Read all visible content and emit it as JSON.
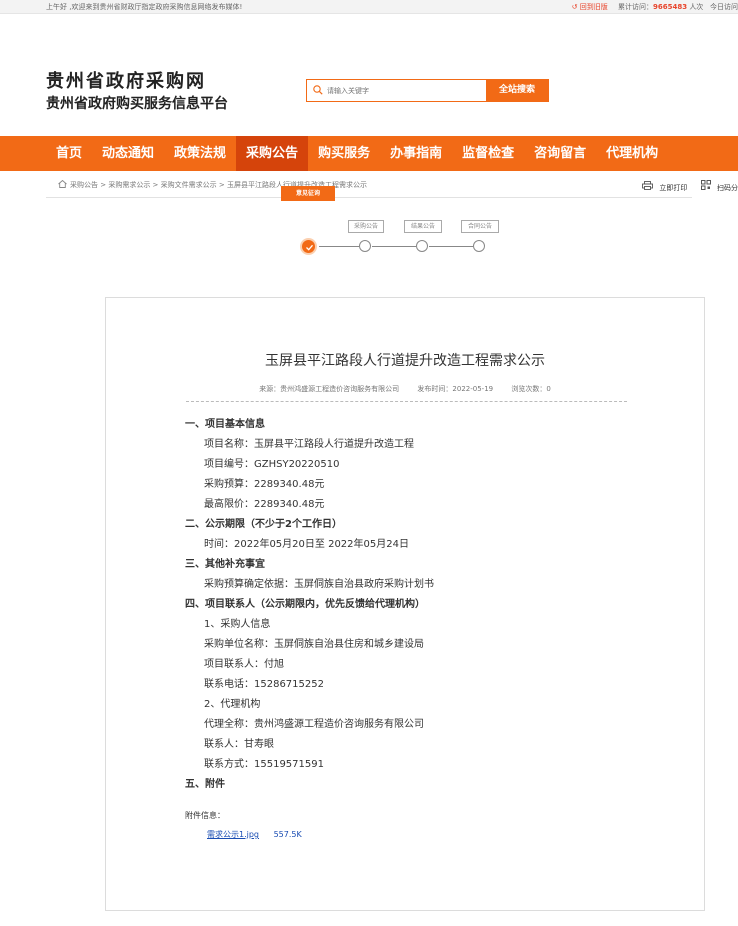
{
  "topbar": {
    "welcome": "上午好 ,欢迎来到贵州省财政厅指定政府采购信息网络发布媒体!",
    "old_version": "回到旧版",
    "visits_label": "累计访问：",
    "visits_count": "9665483",
    "visits_unit": "人次",
    "today_label": "今日访问"
  },
  "header": {
    "logo_line1": "贵州省政府采购网",
    "logo_line2": "贵州省政府购买服务信息平台",
    "search_placeholder": "请输入关键字",
    "search_button": "全站搜索"
  },
  "nav": {
    "items": [
      "首页",
      "动态通知",
      "政策法规",
      "采购公告",
      "购买服务",
      "办事指南",
      "监督检查",
      "咨询留言",
      "代理机构"
    ],
    "active_index": 3
  },
  "breadcrumb": {
    "path": "采购公告 > 采购需求公示 > 采购文件需求公示 > 玉屏县平江路段人行道提升改造工程需求公示",
    "print": "立即打印",
    "scan": "扫码分"
  },
  "steps": {
    "labels": [
      "意见征询",
      "采购公告",
      "结果公告",
      "合同公告"
    ],
    "active_index": 0
  },
  "doc": {
    "title": "玉屏县平江路段人行道提升改造工程需求公示",
    "source": "来源：贵州鸿盛源工程造价咨询服务有限公司",
    "publish_time": "发布时间：2022-05-19",
    "views": "浏览次数：0",
    "lines": [
      {
        "type": "h",
        "text": "一、项目基本信息"
      },
      {
        "type": "b",
        "text": "项目名称：玉屏县平江路段人行道提升改造工程"
      },
      {
        "type": "b",
        "text": "项目编号：GZHSY20220510"
      },
      {
        "type": "b",
        "text": "采购预算：2289340.48元"
      },
      {
        "type": "b",
        "text": "最高限价：2289340.48元"
      },
      {
        "type": "h",
        "text": "二、公示期限（不少于2个工作日）"
      },
      {
        "type": "b",
        "text": "时间：2022年05月20日至 2022年05月24日"
      },
      {
        "type": "h",
        "text": "三、其他补充事宜"
      },
      {
        "type": "b",
        "text": "采购预算确定依据：玉屏侗族自治县政府采购计划书"
      },
      {
        "type": "h",
        "text": "四、项目联系人（公示期限内，优先反馈给代理机构）"
      },
      {
        "type": "b",
        "text": "1、采购人信息"
      },
      {
        "type": "b",
        "text": "采购单位名称：玉屏侗族自治县住房和城乡建设局"
      },
      {
        "type": "b",
        "text": "项目联系人：付旭"
      },
      {
        "type": "b",
        "text": "联系电话：15286715252"
      },
      {
        "type": "b",
        "text": "2、代理机构"
      },
      {
        "type": "b",
        "text": "代理全称：贵州鸿盛源工程造价咨询服务有限公司"
      },
      {
        "type": "b",
        "text": "联系人：甘寿眼"
      },
      {
        "type": "b",
        "text": "联系方式：15519571591"
      },
      {
        "type": "h",
        "text": "五、附件"
      }
    ],
    "attach_label": "附件信息：",
    "attach_file": "需求公示1.jpg",
    "attach_size": "557.5K"
  }
}
